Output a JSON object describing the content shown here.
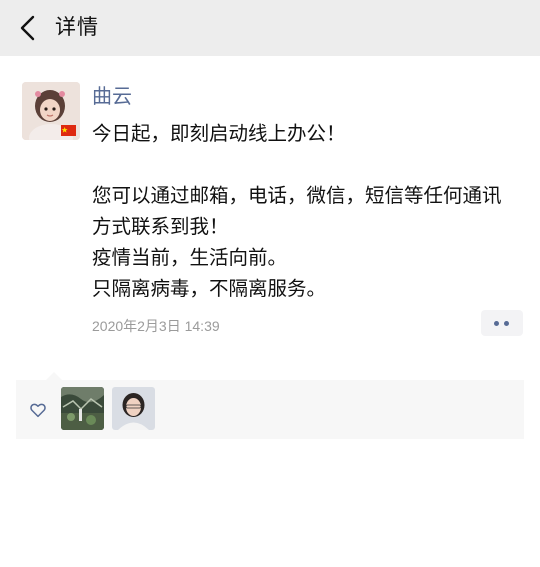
{
  "nav": {
    "title": "详情",
    "back_icon": "chevron-left-icon"
  },
  "post": {
    "author": "曲云",
    "content": "今日起，即刻启动线上办公！\n\n您可以通过邮箱，电话，微信，短信等任何通讯方式联系到我！\n疫情当前，生活向前。\n只隔离病毒，不隔离服务。",
    "timestamp": "2020年2月3日 14:39",
    "more_icon": "more-dots-icon"
  },
  "likes": {
    "icon": "heart-outline-icon",
    "liker_count": 2
  },
  "colors": {
    "nav_bg": "#ededed",
    "name_link": "#576b95",
    "timestamp": "#9b9b9b",
    "likes_bg": "#f7f7f7"
  }
}
